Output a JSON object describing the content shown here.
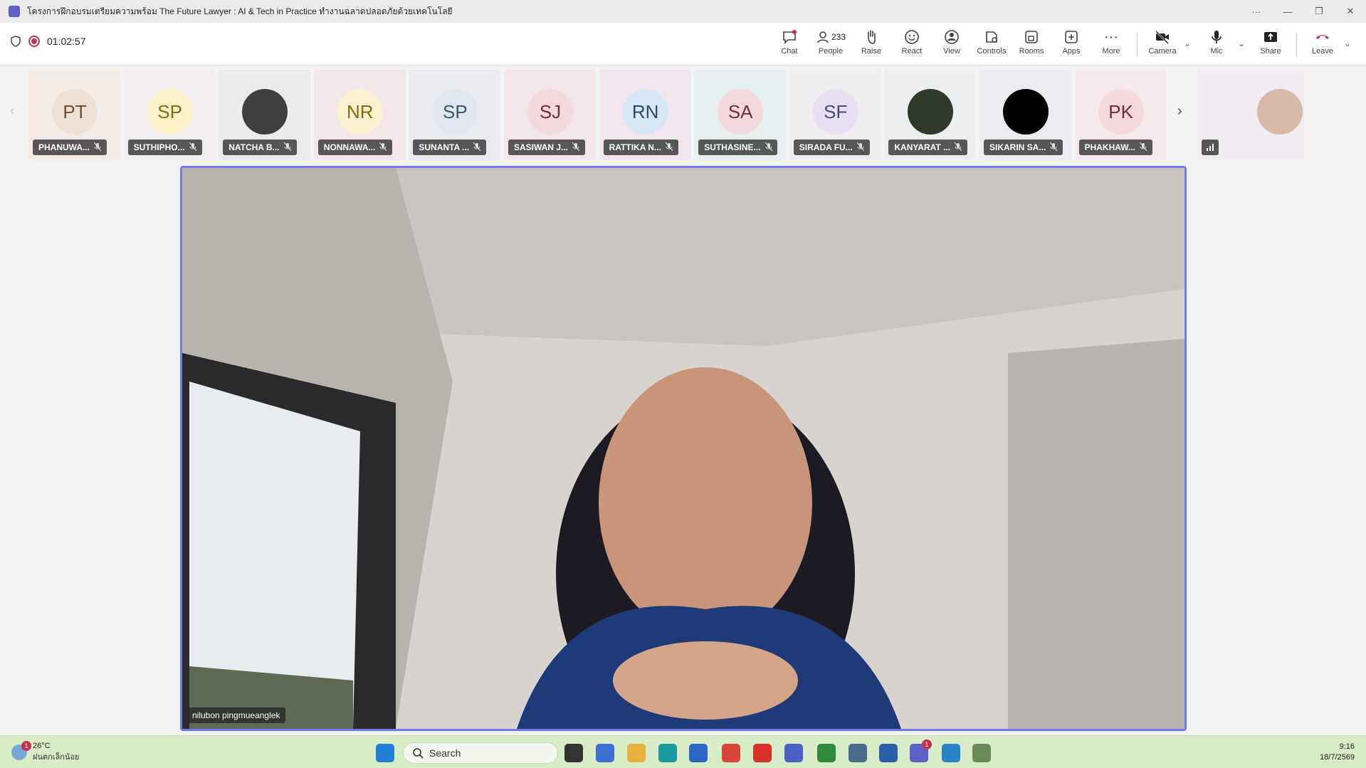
{
  "window": {
    "title": "โครงการฝึกอบรมเตรียมความพร้อม The Future Lawyer : AI & Tech in Practice ทำงานฉลาดปลอดภัยด้วยเทคโนโลยี",
    "controls": [
      "···",
      "—",
      "❐",
      "✕"
    ]
  },
  "toolbar": {
    "timer": "01:02:57",
    "buttons": [
      {
        "label": "Chat",
        "icon": "chat-icon"
      },
      {
        "label": "People",
        "icon": "people-icon",
        "count": "233"
      },
      {
        "label": "Raise",
        "icon": "raise-hand-icon"
      },
      {
        "label": "React",
        "icon": "react-icon"
      },
      {
        "label": "View",
        "icon": "view-icon"
      },
      {
        "label": "Controls",
        "icon": "controls-icon"
      },
      {
        "label": "Rooms",
        "icon": "rooms-icon"
      },
      {
        "label": "Apps",
        "icon": "apps-icon"
      },
      {
        "label": "More",
        "icon": "more-icon"
      },
      {
        "label": "Camera",
        "icon": "camera-off-icon"
      },
      {
        "label": "Mic",
        "icon": "mic-icon"
      },
      {
        "label": "Share",
        "icon": "share-icon"
      },
      {
        "label": "Leave",
        "icon": "leave-icon"
      }
    ]
  },
  "participants": [
    {
      "initials": "PT",
      "name": "PHANUWA...",
      "bg": "#f3ece6",
      "avatar": "#efe0d6",
      "fg": "#7a4a35"
    },
    {
      "initials": "SP",
      "name": "SUTHIPHO...",
      "bg": "#f2eef0",
      "avatar": "#fdf1c9",
      "fg": "#8a6a12"
    },
    {
      "initials": "",
      "name": "NATCHA B...",
      "bg": "#ecebeb",
      "avatar": "#3f3f3f",
      "fg": "#ffffff"
    },
    {
      "initials": "NR",
      "name": "NONNAWA...",
      "bg": "#f3e6e8",
      "avatar": "#fbf0cf",
      "fg": "#8a6a12"
    },
    {
      "initials": "SP",
      "name": "SUNANTA ...",
      "bg": "#eaeaf1",
      "avatar": "#dfe6ef",
      "fg": "#3a5a6a"
    },
    {
      "initials": "SJ",
      "name": "SASIWAN J...",
      "bg": "#f3e6ea",
      "avatar": "#f3d9dd",
      "fg": "#7a2a35"
    },
    {
      "initials": "RN",
      "name": "RATTIKA N...",
      "bg": "#f1e6ee",
      "avatar": "#d7e6f5",
      "fg": "#2a4a6a"
    },
    {
      "initials": "SA",
      "name": "SUTHASINE...",
      "bg": "#e7eef0",
      "avatar": "#f3d9dd",
      "fg": "#7a2a35"
    },
    {
      "initials": "SF",
      "name": "SIRADA FU...",
      "bg": "#f0edf0",
      "avatar": "#e6e0f2",
      "fg": "#4a4a7a"
    },
    {
      "initials": "",
      "name": "KANYARAT ...",
      "bg": "#edeef0",
      "avatar": "#2f3a2a",
      "fg": "#ffffff"
    },
    {
      "initials": "",
      "name": "SIKARIN SA...",
      "bg": "#ecebef",
      "avatar": "#000000",
      "fg": "#ffffff"
    },
    {
      "initials": "PK",
      "name": "PHAKHAW...",
      "bg": "#f5e9ec",
      "avatar": "#f5d9dd",
      "fg": "#7a2a35"
    }
  ],
  "self_tile": {
    "bg": "#f2ebf1",
    "avatar": "#d8b8a8"
  },
  "main_video": {
    "speaker": "nilubon pingmueanglek"
  },
  "taskbar": {
    "weather_temp": "26°C",
    "weather_desc": "ฝนตกเล็กน้อย",
    "weather_badge": "1",
    "search_placeholder": "Search",
    "time": "9:16",
    "date": "18/7/2569",
    "teams_badge": "1",
    "apps": [
      {
        "name": "windows-start-icon",
        "color": "#1f7ed6"
      },
      {
        "name": "task-view-icon",
        "color": "#333333"
      },
      {
        "name": "m365-icon",
        "color": "#3b6fd1"
      },
      {
        "name": "file-explorer-icon",
        "color": "#e8b23a"
      },
      {
        "name": "edge-icon",
        "color": "#1b9a9f"
      },
      {
        "name": "store-icon",
        "color": "#2b66c4"
      },
      {
        "name": "chrome-icon",
        "color": "#d9453a"
      },
      {
        "name": "acrobat-icon",
        "color": "#d9302a"
      },
      {
        "name": "settings-app-icon",
        "color": "#4a5fc4"
      },
      {
        "name": "chrome-profile-icon",
        "color": "#2f8a3e"
      },
      {
        "name": "calculator-icon",
        "color": "#4a6a8a"
      },
      {
        "name": "word-icon",
        "color": "#2b5faa"
      },
      {
        "name": "teams-icon",
        "color": "#5b5fc7"
      },
      {
        "name": "photos-icon",
        "color": "#2a83c8"
      },
      {
        "name": "snipping-tool-icon",
        "color": "#6a8a5a"
      }
    ]
  }
}
